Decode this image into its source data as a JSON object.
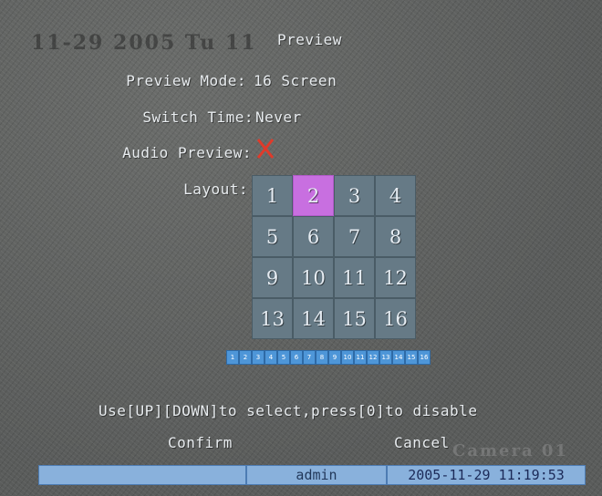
{
  "window": {
    "title": "Preview",
    "bg_datetime": "11-29 2005 Tu 11"
  },
  "fields": {
    "preview_mode": {
      "label": "Preview Mode:",
      "value": "16 Screen"
    },
    "switch_time": {
      "label": "Switch Time:",
      "value": "Never"
    },
    "audio_preview": {
      "label": "Audio Preview:",
      "state_icon": "x-mark-icon",
      "enabled": false
    },
    "layout": {
      "label": "Layout:"
    }
  },
  "layout_grid": {
    "cells": [
      "1",
      "2",
      "3",
      "4",
      "5",
      "6",
      "7",
      "8",
      "9",
      "10",
      "11",
      "12",
      "13",
      "14",
      "15",
      "16"
    ],
    "selected": "2"
  },
  "channel_strip": [
    "1",
    "2",
    "3",
    "4",
    "5",
    "6",
    "7",
    "8",
    "9",
    "10",
    "11",
    "12",
    "13",
    "14",
    "15",
    "16"
  ],
  "hint": "Use[UP][DOWN]to select,press[0]to disable",
  "buttons": {
    "confirm": "Confirm",
    "cancel": "Cancel"
  },
  "watermark": "Camera 01",
  "status_bar": {
    "segment1": "",
    "user": "admin",
    "datetime": "2005-11-29 11:19:53"
  },
  "colors": {
    "cell": "#667a86",
    "selected_cell": "#c86fe0",
    "status_bar": "#89b1dc",
    "disabled_mark": "#e03a2a"
  }
}
